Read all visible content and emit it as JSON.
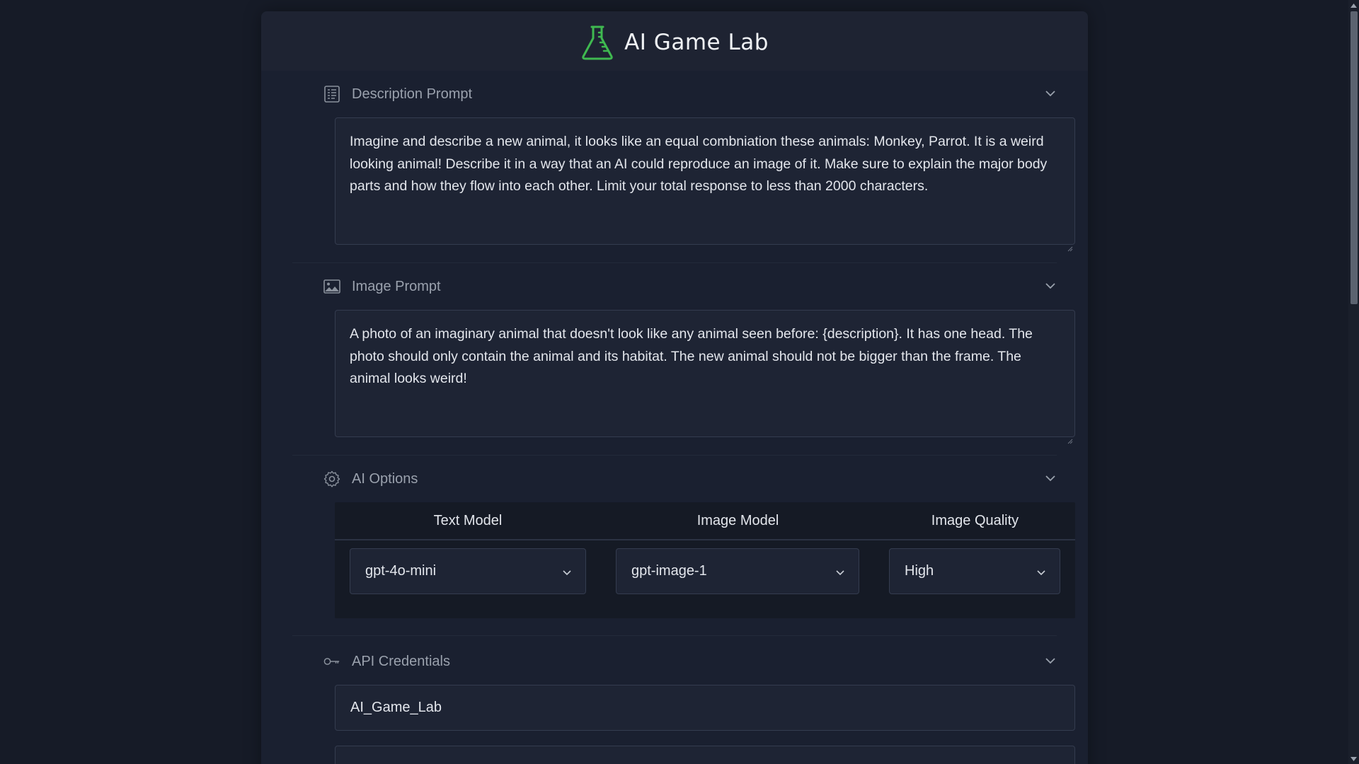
{
  "app": {
    "title": "AI Game Lab"
  },
  "sections": {
    "description": {
      "title": "Description Prompt",
      "value": "Imagine and describe a new animal, it looks like an equal combniation these animals: Monkey, Parrot. It is a weird looking animal! Describe it in a way that an AI could reproduce an image of it.  Make sure to explain the major body parts and how they flow into each other. Limit your total response to less than 2000 characters."
    },
    "image": {
      "title": "Image Prompt",
      "value": "A photo of an imaginary animal that doesn't look like any animal seen before: {description}. It has one head. The photo should only contain the animal and its habitat. The new animal should not be bigger than the frame. The animal looks weird!"
    },
    "options": {
      "title": "AI Options",
      "columns": [
        "Text Model",
        "Image Model",
        "Image Quality"
      ],
      "text_model": "gpt-4o-mini",
      "image_model": "gpt-image-1",
      "image_quality": "High"
    },
    "credentials": {
      "title": "API Credentials",
      "project_value": "AI_Game_Lab"
    }
  },
  "icons": {
    "logo": "flask-icon",
    "description": "document-list-icon",
    "image": "image-icon",
    "options": "gear-icon",
    "credentials": "key-icon",
    "collapse": "chevron-down-icon"
  },
  "colors": {
    "accent": "#3fb950",
    "background": "#161b27",
    "card": "#1a2030"
  }
}
